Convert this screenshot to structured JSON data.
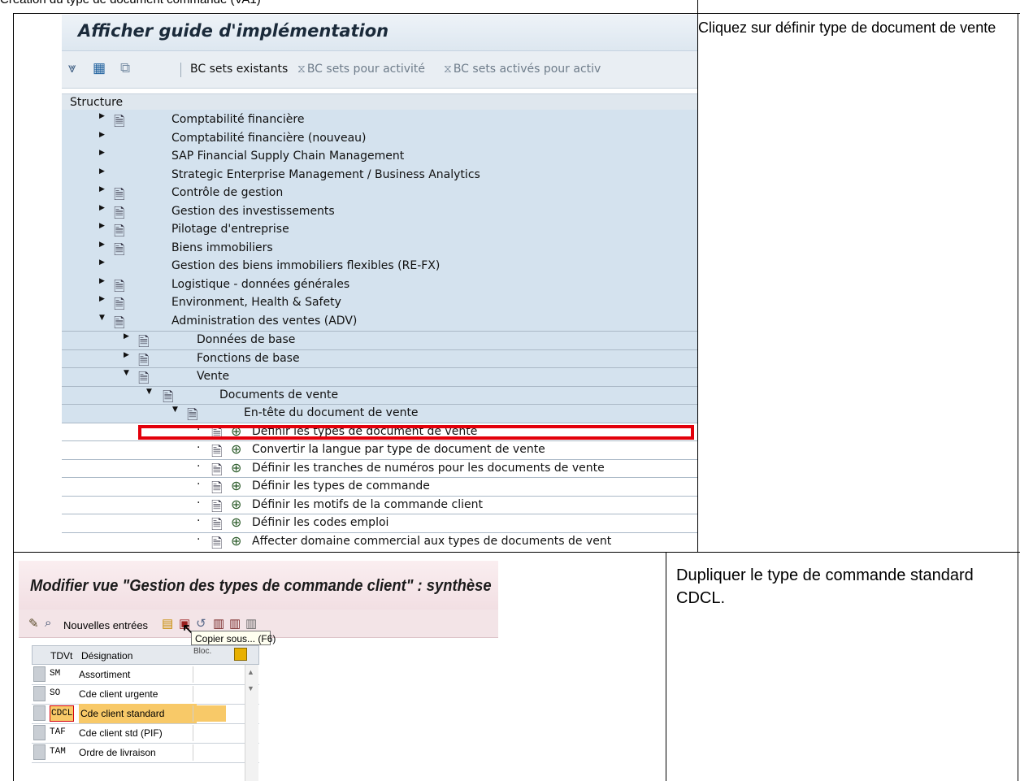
{
  "document": {
    "heading": "Création du type de document commande (VA1)"
  },
  "step1": {
    "window_title": "Afficher guide d'implémentation",
    "toolbar": {
      "bc_sets_existing": "BC sets existants",
      "bc_sets_activity": "BC sets pour activité",
      "bc_sets_activated": "BC sets activés pour activ"
    },
    "structure_label": "Structure",
    "tree": [
      {
        "label": "Comptabilité financière",
        "level": 0,
        "expanded": false,
        "has_node_icon": true
      },
      {
        "label": "Comptabilité financière (nouveau)",
        "level": 0,
        "expanded": false,
        "has_node_icon": false
      },
      {
        "label": "SAP Financial Supply Chain Management",
        "level": 0,
        "expanded": false,
        "has_node_icon": false
      },
      {
        "label": "Strategic Enterprise Management / Business Analytics",
        "level": 0,
        "expanded": false,
        "has_node_icon": false
      },
      {
        "label": "Contrôle de gestion",
        "level": 0,
        "expanded": false,
        "has_node_icon": true
      },
      {
        "label": "Gestion des investissements",
        "level": 0,
        "expanded": false,
        "has_node_icon": true
      },
      {
        "label": "Pilotage d'entreprise",
        "level": 0,
        "expanded": false,
        "has_node_icon": true
      },
      {
        "label": "Biens immobiliers",
        "level": 0,
        "expanded": false,
        "has_node_icon": true
      },
      {
        "label": "Gestion des biens immobiliers flexibles (RE-FX)",
        "level": 0,
        "expanded": false,
        "has_node_icon": false
      },
      {
        "label": "Logistique - données générales",
        "level": 0,
        "expanded": false,
        "has_node_icon": true
      },
      {
        "label": "Environment, Health & Safety",
        "level": 0,
        "expanded": false,
        "has_node_icon": true
      },
      {
        "label": "Administration des ventes (ADV)",
        "level": 0,
        "expanded": true,
        "has_node_icon": true
      },
      {
        "label": "Données de base",
        "level": 1,
        "expanded": false,
        "has_node_icon": true
      },
      {
        "label": "Fonctions de base",
        "level": 1,
        "expanded": false,
        "has_node_icon": true
      },
      {
        "label": "Vente",
        "level": 1,
        "expanded": true,
        "has_node_icon": true
      },
      {
        "label": "Documents de vente",
        "level": 2,
        "expanded": true,
        "has_node_icon": true
      },
      {
        "label": "En-tête du document de vente",
        "level": 3,
        "expanded": true,
        "has_node_icon": true
      },
      {
        "label": "Définir les types de document de vente",
        "level": 4,
        "leaf": true
      },
      {
        "label": "Convertir la langue par type de document de vente",
        "level": 4,
        "leaf": true
      },
      {
        "label": "Définir les tranches de numéros pour les documents de vente",
        "level": 4,
        "leaf": true
      },
      {
        "label": "Définir les types de commande",
        "level": 4,
        "leaf": true
      },
      {
        "label": "Définir les motifs de la commande client",
        "level": 4,
        "leaf": true
      },
      {
        "label": "Définir les codes emploi",
        "level": 4,
        "leaf": true
      },
      {
        "label": "Affecter domaine commercial aux types de documents de vent",
        "level": 4,
        "leaf": true
      }
    ],
    "instruction": "Cliquez sur définir type de document de vente"
  },
  "step2": {
    "window_title": "Modifier vue \"Gestion des types de commande client\" : synthèse",
    "toolbar": {
      "new_entries": "Nouvelles entrées"
    },
    "tooltip": "Copier sous... (F6)",
    "table": {
      "headers": [
        "TDVt",
        "Désignation",
        "Bloc."
      ],
      "rows": [
        {
          "code": "SM",
          "desc": "Assortiment"
        },
        {
          "code": "SO",
          "desc": "Cde client urgente"
        },
        {
          "code": "CDCL",
          "desc": "Cde client standard",
          "selected": true
        },
        {
          "code": "TAF",
          "desc": "Cde client std (PIF)"
        },
        {
          "code": "TAM",
          "desc": "Ordre de livraison"
        }
      ]
    },
    "instruction": "Dupliquer le type de commande standard CDCL."
  },
  "colors": {
    "highlight_box": "#e3000b",
    "sap_tree_bg": "#d4e2ee",
    "selected_row": "#f8c968"
  }
}
